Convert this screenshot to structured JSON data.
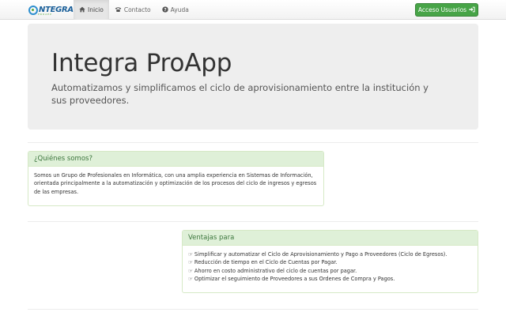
{
  "navbar": {
    "brand_text": "NTEGRA",
    "brand_sub": "PROAPP",
    "items": [
      {
        "label": "Inicio",
        "icon": "home-icon",
        "active": true
      },
      {
        "label": "Contacto",
        "icon": "phone-icon",
        "active": false
      },
      {
        "label": "Ayuda",
        "icon": "question-circle-icon",
        "active": false
      }
    ],
    "login_label": "Acceso Usuarios",
    "login_icon": "sign-in-icon"
  },
  "jumbotron": {
    "title": "Integra ProApp",
    "lead": "Automatizamos y simplificamos el ciclo de aprovisionamiento entre la institución y sus proveedores."
  },
  "about": {
    "heading": "¿Quiénes somos?",
    "body": "Somos un Grupo de Profesionales en Informática, con una amplia experiencia en Sistemas de Información, orientada principalmente a la automatización y optimización de los procesos del ciclo de ingresos y egresos de las empresas."
  },
  "advantages": {
    "heading": "Ventajas para",
    "items": [
      "Simplificar y automatizar el Ciclo de Aprovisionamiento y Pago a Proveedores (Ciclo de Egresos).",
      "Reducción de tiempo en el Ciclo de Cuentas por Pagar.",
      "Ahorro en costo administrativo del ciclo de cuentas por pagar.",
      "Optimizar el seguimiento de Proveedores a sus Ordenes de Compra y Pagos."
    ]
  },
  "colors": {
    "success": "#47a447",
    "panel_heading_bg": "#dff0d8",
    "panel_heading_text": "#3c763d",
    "jumbotron_bg": "#eeeeee"
  }
}
